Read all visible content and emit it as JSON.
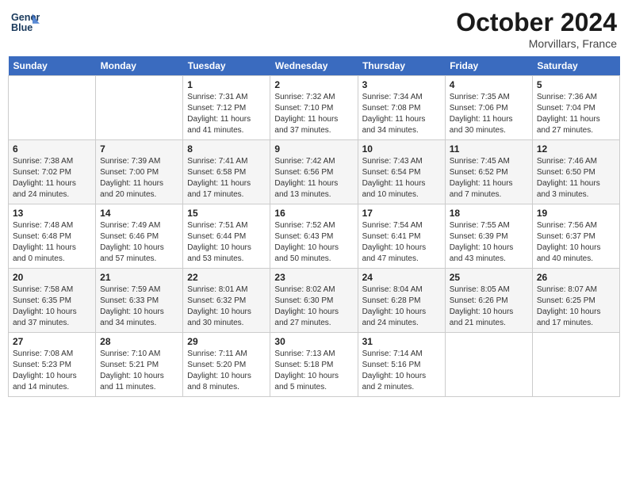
{
  "header": {
    "logo": "GeneralBlue",
    "month": "October 2024",
    "location": "Morvillars, France"
  },
  "weekdays": [
    "Sunday",
    "Monday",
    "Tuesday",
    "Wednesday",
    "Thursday",
    "Friday",
    "Saturday"
  ],
  "weeks": [
    [
      {
        "day": null,
        "sunrise": null,
        "sunset": null,
        "daylight": null
      },
      {
        "day": null,
        "sunrise": null,
        "sunset": null,
        "daylight": null
      },
      {
        "day": 1,
        "sunrise": "Sunrise: 7:31 AM",
        "sunset": "Sunset: 7:12 PM",
        "daylight": "Daylight: 11 hours and 41 minutes."
      },
      {
        "day": 2,
        "sunrise": "Sunrise: 7:32 AM",
        "sunset": "Sunset: 7:10 PM",
        "daylight": "Daylight: 11 hours and 37 minutes."
      },
      {
        "day": 3,
        "sunrise": "Sunrise: 7:34 AM",
        "sunset": "Sunset: 7:08 PM",
        "daylight": "Daylight: 11 hours and 34 minutes."
      },
      {
        "day": 4,
        "sunrise": "Sunrise: 7:35 AM",
        "sunset": "Sunset: 7:06 PM",
        "daylight": "Daylight: 11 hours and 30 minutes."
      },
      {
        "day": 5,
        "sunrise": "Sunrise: 7:36 AM",
        "sunset": "Sunset: 7:04 PM",
        "daylight": "Daylight: 11 hours and 27 minutes."
      }
    ],
    [
      {
        "day": 6,
        "sunrise": "Sunrise: 7:38 AM",
        "sunset": "Sunset: 7:02 PM",
        "daylight": "Daylight: 11 hours and 24 minutes."
      },
      {
        "day": 7,
        "sunrise": "Sunrise: 7:39 AM",
        "sunset": "Sunset: 7:00 PM",
        "daylight": "Daylight: 11 hours and 20 minutes."
      },
      {
        "day": 8,
        "sunrise": "Sunrise: 7:41 AM",
        "sunset": "Sunset: 6:58 PM",
        "daylight": "Daylight: 11 hours and 17 minutes."
      },
      {
        "day": 9,
        "sunrise": "Sunrise: 7:42 AM",
        "sunset": "Sunset: 6:56 PM",
        "daylight": "Daylight: 11 hours and 13 minutes."
      },
      {
        "day": 10,
        "sunrise": "Sunrise: 7:43 AM",
        "sunset": "Sunset: 6:54 PM",
        "daylight": "Daylight: 11 hours and 10 minutes."
      },
      {
        "day": 11,
        "sunrise": "Sunrise: 7:45 AM",
        "sunset": "Sunset: 6:52 PM",
        "daylight": "Daylight: 11 hours and 7 minutes."
      },
      {
        "day": 12,
        "sunrise": "Sunrise: 7:46 AM",
        "sunset": "Sunset: 6:50 PM",
        "daylight": "Daylight: 11 hours and 3 minutes."
      }
    ],
    [
      {
        "day": 13,
        "sunrise": "Sunrise: 7:48 AM",
        "sunset": "Sunset: 6:48 PM",
        "daylight": "Daylight: 11 hours and 0 minutes."
      },
      {
        "day": 14,
        "sunrise": "Sunrise: 7:49 AM",
        "sunset": "Sunset: 6:46 PM",
        "daylight": "Daylight: 10 hours and 57 minutes."
      },
      {
        "day": 15,
        "sunrise": "Sunrise: 7:51 AM",
        "sunset": "Sunset: 6:44 PM",
        "daylight": "Daylight: 10 hours and 53 minutes."
      },
      {
        "day": 16,
        "sunrise": "Sunrise: 7:52 AM",
        "sunset": "Sunset: 6:43 PM",
        "daylight": "Daylight: 10 hours and 50 minutes."
      },
      {
        "day": 17,
        "sunrise": "Sunrise: 7:54 AM",
        "sunset": "Sunset: 6:41 PM",
        "daylight": "Daylight: 10 hours and 47 minutes."
      },
      {
        "day": 18,
        "sunrise": "Sunrise: 7:55 AM",
        "sunset": "Sunset: 6:39 PM",
        "daylight": "Daylight: 10 hours and 43 minutes."
      },
      {
        "day": 19,
        "sunrise": "Sunrise: 7:56 AM",
        "sunset": "Sunset: 6:37 PM",
        "daylight": "Daylight: 10 hours and 40 minutes."
      }
    ],
    [
      {
        "day": 20,
        "sunrise": "Sunrise: 7:58 AM",
        "sunset": "Sunset: 6:35 PM",
        "daylight": "Daylight: 10 hours and 37 minutes."
      },
      {
        "day": 21,
        "sunrise": "Sunrise: 7:59 AM",
        "sunset": "Sunset: 6:33 PM",
        "daylight": "Daylight: 10 hours and 34 minutes."
      },
      {
        "day": 22,
        "sunrise": "Sunrise: 8:01 AM",
        "sunset": "Sunset: 6:32 PM",
        "daylight": "Daylight: 10 hours and 30 minutes."
      },
      {
        "day": 23,
        "sunrise": "Sunrise: 8:02 AM",
        "sunset": "Sunset: 6:30 PM",
        "daylight": "Daylight: 10 hours and 27 minutes."
      },
      {
        "day": 24,
        "sunrise": "Sunrise: 8:04 AM",
        "sunset": "Sunset: 6:28 PM",
        "daylight": "Daylight: 10 hours and 24 minutes."
      },
      {
        "day": 25,
        "sunrise": "Sunrise: 8:05 AM",
        "sunset": "Sunset: 6:26 PM",
        "daylight": "Daylight: 10 hours and 21 minutes."
      },
      {
        "day": 26,
        "sunrise": "Sunrise: 8:07 AM",
        "sunset": "Sunset: 6:25 PM",
        "daylight": "Daylight: 10 hours and 17 minutes."
      }
    ],
    [
      {
        "day": 27,
        "sunrise": "Sunrise: 7:08 AM",
        "sunset": "Sunset: 5:23 PM",
        "daylight": "Daylight: 10 hours and 14 minutes."
      },
      {
        "day": 28,
        "sunrise": "Sunrise: 7:10 AM",
        "sunset": "Sunset: 5:21 PM",
        "daylight": "Daylight: 10 hours and 11 minutes."
      },
      {
        "day": 29,
        "sunrise": "Sunrise: 7:11 AM",
        "sunset": "Sunset: 5:20 PM",
        "daylight": "Daylight: 10 hours and 8 minutes."
      },
      {
        "day": 30,
        "sunrise": "Sunrise: 7:13 AM",
        "sunset": "Sunset: 5:18 PM",
        "daylight": "Daylight: 10 hours and 5 minutes."
      },
      {
        "day": 31,
        "sunrise": "Sunrise: 7:14 AM",
        "sunset": "Sunset: 5:16 PM",
        "daylight": "Daylight: 10 hours and 2 minutes."
      },
      {
        "day": null,
        "sunrise": null,
        "sunset": null,
        "daylight": null
      },
      {
        "day": null,
        "sunrise": null,
        "sunset": null,
        "daylight": null
      }
    ]
  ]
}
